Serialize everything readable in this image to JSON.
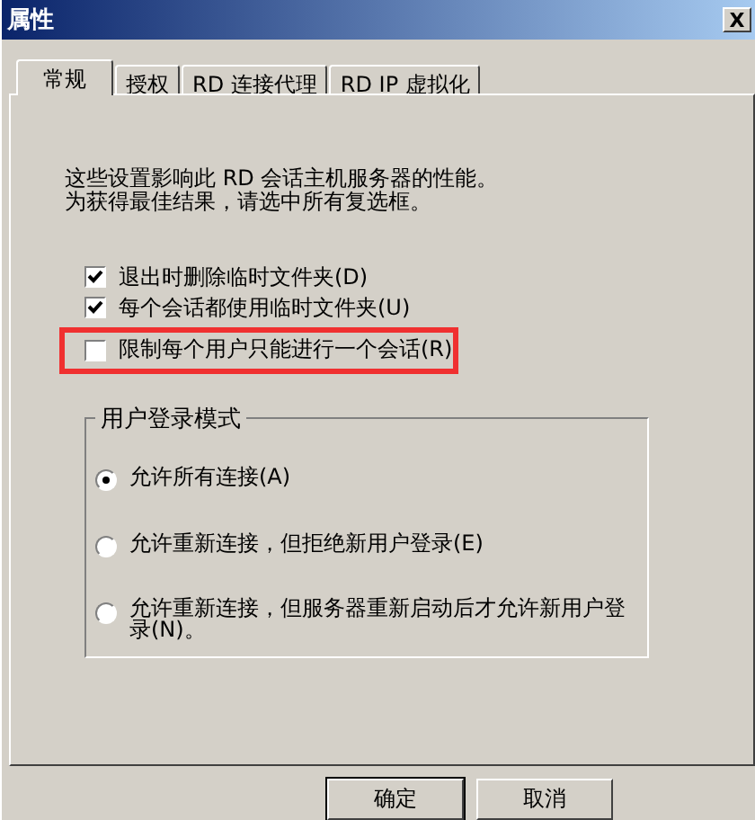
{
  "window": {
    "title": "属性",
    "close": "X"
  },
  "tabs": [
    {
      "label": "常规",
      "selected": true
    },
    {
      "label": "授权",
      "selected": false
    },
    {
      "label": "RD 连接代理",
      "selected": false
    },
    {
      "label": "RD IP 虚拟化",
      "selected": false
    }
  ],
  "description": [
    "这些设置影响此 RD 会话主机服务器的性能。",
    "为获得最佳结果，请选中所有复选框。"
  ],
  "checkboxes": [
    {
      "label": "退出时删除临时文件夹(D)",
      "checked": true,
      "highlighted": false
    },
    {
      "label": "每个会话都使用临时文件夹(U)",
      "checked": true,
      "highlighted": false
    },
    {
      "label": "限制每个用户只能进行一个会话(R)",
      "checked": false,
      "highlighted": true
    }
  ],
  "logon_mode": {
    "title": "用户登录模式",
    "options": [
      {
        "label": "允许所有连接(A)",
        "selected": true
      },
      {
        "label": "允许重新连接，但拒绝新用户登录(E)",
        "selected": false
      },
      {
        "label": "允许重新连接，但服务器重新启动后才允许新用户登录(N)。",
        "selected": false
      }
    ]
  },
  "buttons": [
    {
      "label": "确定",
      "default": true
    },
    {
      "label": "取消",
      "default": false
    }
  ]
}
